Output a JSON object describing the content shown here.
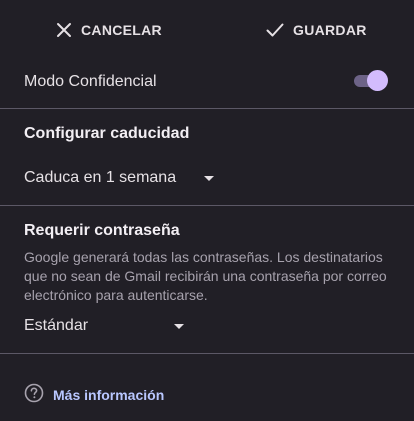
{
  "toolbar": {
    "cancel_label": "CANCELAR",
    "save_label": "GUARDAR"
  },
  "confidential": {
    "label": "Modo Confidencial",
    "enabled": true
  },
  "expiration": {
    "title": "Configurar caducidad",
    "selected": "Caduca en 1 semana"
  },
  "password": {
    "title": "Requerir contraseña",
    "description": "Google generará todas las contraseñas. Los destinatarios que no sean de Gmail recibirán una contraseña por correo electrónico para autenticarse.",
    "selected": "Estándar"
  },
  "info": {
    "label": "Más información"
  },
  "icons": {
    "cancel": "close-icon",
    "save": "check-icon",
    "info": "help-circle-icon",
    "dropdown": "dropdown-arrow-icon"
  },
  "colors": {
    "background": "#211f26",
    "accent_thumb": "#d3bcfd",
    "accent_track": "#6d6387",
    "link": "#b9c7ff",
    "divider": "#5c5866"
  }
}
